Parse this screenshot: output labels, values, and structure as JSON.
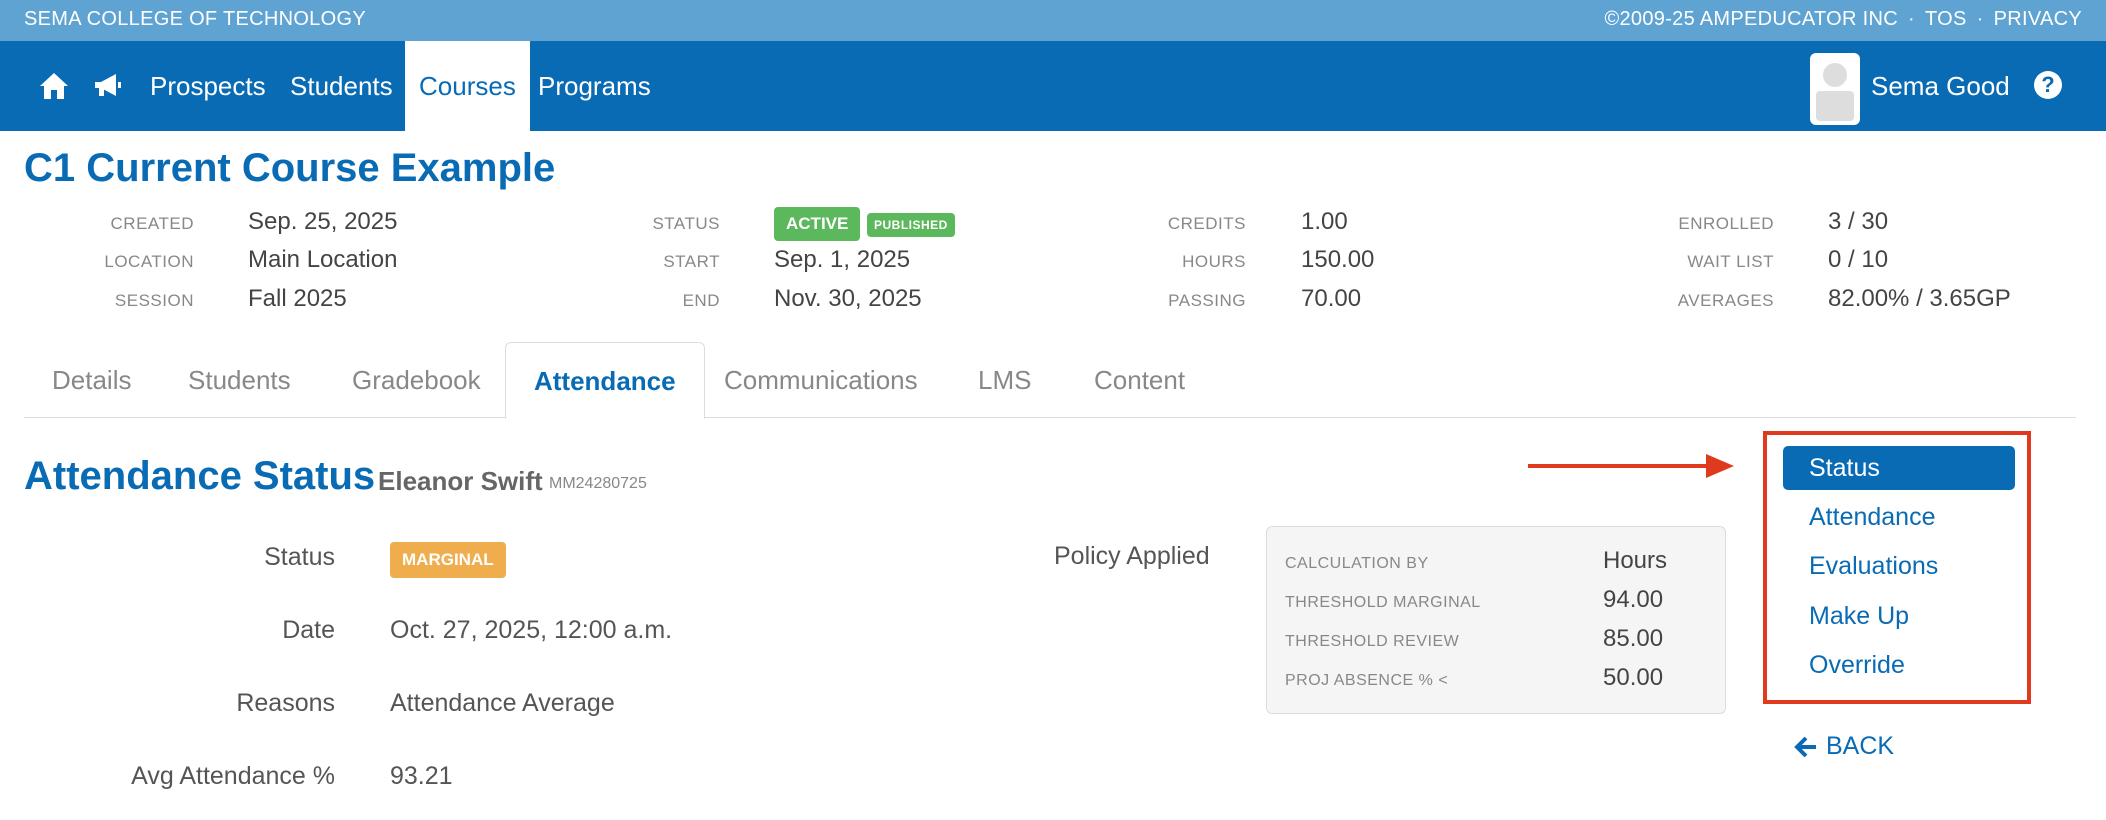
{
  "topbar": {
    "school": "SEMA COLLEGE OF TECHNOLOGY",
    "copyright": "©2009-25 AMPEDUCATOR INC",
    "tos": "TOS",
    "privacy": "PRIVACY",
    "separator": "·"
  },
  "nav": {
    "home_icon": "home-icon",
    "announce_icon": "megaphone-icon",
    "items": [
      {
        "label": "Prospects"
      },
      {
        "label": "Students"
      },
      {
        "label": "Courses"
      },
      {
        "label": "Programs"
      }
    ],
    "active": "Courses",
    "user_name": "Sema Good",
    "help_glyph": "?"
  },
  "course": {
    "title": "C1 Current Course Example",
    "created_label": "CREATED",
    "created": "Sep. 25, 2025",
    "location_label": "LOCATION",
    "location": "Main Location",
    "session_label": "SESSION",
    "session": "Fall 2025",
    "status_label": "STATUS",
    "status_badge": "ACTIVE",
    "published_badge": "PUBLISHED",
    "start_label": "START",
    "start": "Sep. 1, 2025",
    "end_label": "END",
    "end": "Nov. 30, 2025",
    "credits_label": "CREDITS",
    "credits": "1.00",
    "hours_label": "HOURS",
    "hours": "150.00",
    "passing_label": "PASSING",
    "passing": "70.00",
    "enrolled_label": "ENROLLED",
    "enrolled": "3 / 30",
    "waitlist_label": "WAIT LIST",
    "waitlist": "0 / 10",
    "averages_label": "AVERAGES",
    "averages": "82.00% / 3.65GP"
  },
  "tabs": [
    {
      "label": "Details"
    },
    {
      "label": "Students"
    },
    {
      "label": "Gradebook"
    },
    {
      "label": "Attendance"
    },
    {
      "label": "Communications"
    },
    {
      "label": "LMS"
    },
    {
      "label": "Content"
    }
  ],
  "attendance": {
    "title": "Attendance Status",
    "student_name": "Eleanor Swift",
    "student_id": "MM24280725",
    "status_label": "Status",
    "status_badge": "MARGINAL",
    "date_label": "Date",
    "date": "Oct. 27, 2025, 12:00 a.m.",
    "reasons_label": "Reasons",
    "reasons": "Attendance Average",
    "avg_label": "Avg Attendance %",
    "avg": "93.21"
  },
  "policy": {
    "label": "Policy Applied",
    "calc_label": "CALCULATION BY",
    "calc": "Hours",
    "marginal_label": "THRESHOLD MARGINAL",
    "marginal": "94.00",
    "review_label": "THRESHOLD REVIEW",
    "review": "85.00",
    "absence_label": "PROJ ABSENCE % <",
    "absence": "50.00"
  },
  "side_menu": {
    "items": [
      {
        "label": "Status"
      },
      {
        "label": "Attendance"
      },
      {
        "label": "Evaluations"
      },
      {
        "label": "Make Up"
      },
      {
        "label": "Override"
      }
    ],
    "active": "Status",
    "back_label": "BACK"
  },
  "colors": {
    "brand": "#0a6bb5",
    "topstrip": "#5fa3d3",
    "active_badge": "#5cb85c",
    "marginal_badge": "#f0ad4e",
    "highlight": "#e03a1e"
  }
}
